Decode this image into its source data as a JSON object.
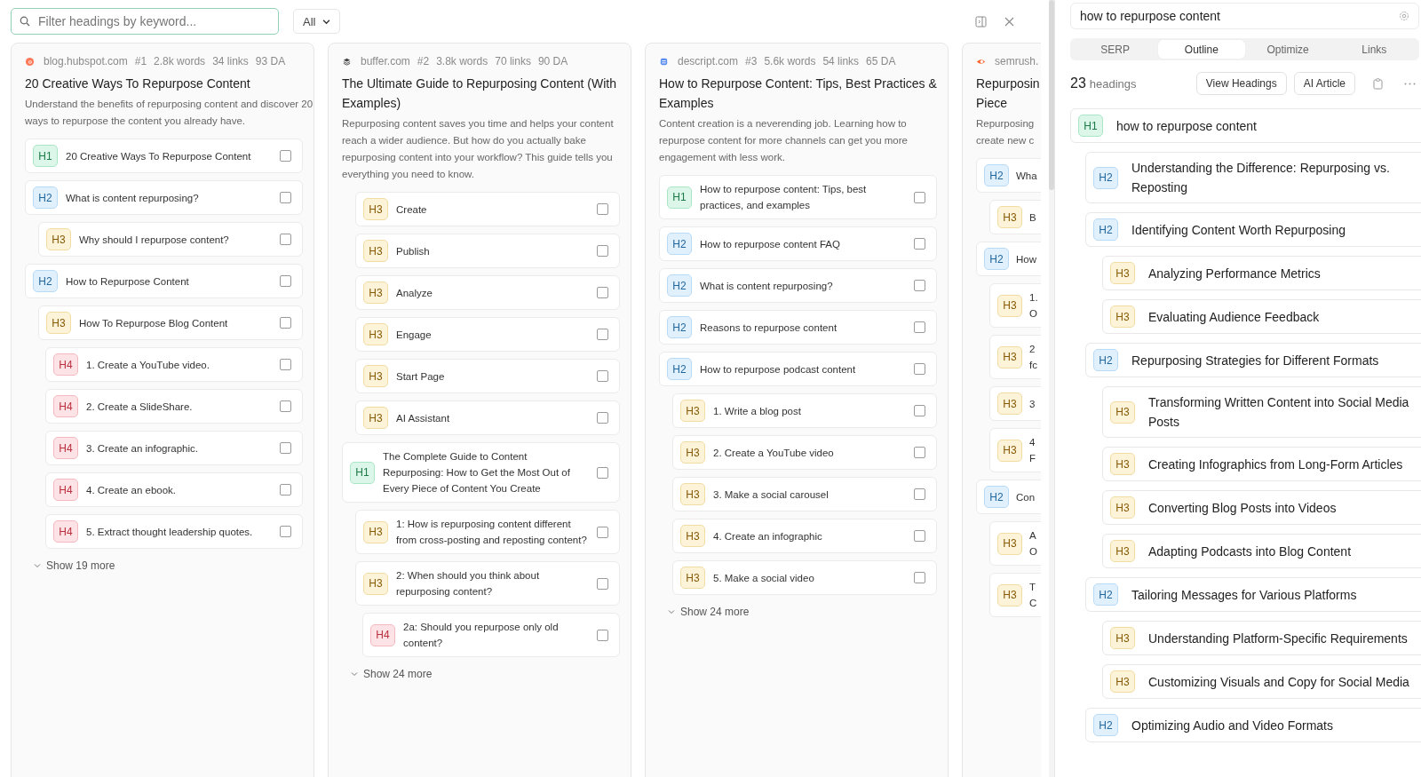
{
  "filter": {
    "placeholder": "Filter headings by keyword..."
  },
  "type_filter": {
    "value": "All"
  },
  "columns": [
    {
      "site": "blog.hubspot.com",
      "rank": "#1",
      "words": "2.8k words",
      "links": "34 links",
      "da": "93 DA",
      "title": "20 Creative Ways To Repurpose Content",
      "description": "Understand the benefits of repurposing content and discover 20 ways to repurpose the content you already have.",
      "headings": [
        {
          "tag": "H1",
          "kind": "h1",
          "text": "20 Creative Ways To Repurpose Content",
          "checked": false
        },
        {
          "tag": "H2",
          "kind": "h2",
          "text": "What is content repurposing?",
          "checked": false
        },
        {
          "tag": "H3",
          "kind": "h3",
          "text": "Why should I repurpose content?",
          "checked": false
        },
        {
          "tag": "H2",
          "kind": "h2",
          "text": "How to Repurpose Content",
          "checked": false
        },
        {
          "tag": "H3",
          "kind": "h3",
          "text": "How To Repurpose Blog Content",
          "checked": false
        },
        {
          "tag": "H4",
          "kind": "h4",
          "text": "1. Create a YouTube video.",
          "checked": false
        },
        {
          "tag": "H4",
          "kind": "h4",
          "text": "2. Create a SlideShare.",
          "checked": false
        },
        {
          "tag": "H4",
          "kind": "h4",
          "text": "3. Create an infographic.",
          "checked": false
        },
        {
          "tag": "H4",
          "kind": "h4",
          "text": "4. Create an ebook.",
          "checked": false
        },
        {
          "tag": "H4",
          "kind": "h4",
          "text": "5. Extract thought leadership quotes.",
          "checked": false
        }
      ],
      "show_more": "Show 19 more"
    },
    {
      "site": "buffer.com",
      "rank": "#2",
      "words": "3.8k words",
      "links": "70 links",
      "da": "90 DA",
      "title": "The Ultimate Guide to Repurposing Content (With Examples)",
      "description": "Repurposing content saves you time and helps your content reach a wider audience. But how do you actually bake repurposing content into your workflow? This guide tells you everything you need to know.",
      "headings": [
        {
          "tag": "H3",
          "kind": "h3",
          "text": "Create",
          "checked": false
        },
        {
          "tag": "H3",
          "kind": "h3",
          "text": "Publish",
          "checked": false
        },
        {
          "tag": "H3",
          "kind": "h3",
          "text": "Analyze",
          "checked": false
        },
        {
          "tag": "H3",
          "kind": "h3",
          "text": "Engage",
          "checked": false
        },
        {
          "tag": "H3",
          "kind": "h3",
          "text": "Start Page",
          "checked": false
        },
        {
          "tag": "H3",
          "kind": "h3",
          "text": "AI Assistant",
          "checked": false
        },
        {
          "tag": "H1",
          "kind": "h1",
          "text": "The Complete Guide to Content Repurposing: How to Get the Most Out of Every Piece of Content You Create",
          "checked": false
        },
        {
          "tag": "H3",
          "kind": "h3",
          "text": "1: How is repurposing content different from cross-posting and reposting content?",
          "checked": false
        },
        {
          "tag": "H3",
          "kind": "h3",
          "text": "2: When should you think about repurposing content?",
          "checked": false
        },
        {
          "tag": "H4",
          "kind": "h4",
          "text": "2a: Should you repurpose only old content?",
          "checked": false
        }
      ],
      "show_more": "Show 24 more"
    },
    {
      "site": "descript.com",
      "rank": "#3",
      "words": "5.6k words",
      "links": "54 links",
      "da": "65 DA",
      "title": "How to Repurpose Content: Tips, Best Practices & Examples",
      "description": "Content creation is a neverending job. Learning how to repurpose content for more channels can get you more engagement with less work.",
      "headings": [
        {
          "tag": "H1",
          "kind": "h1",
          "text": "How to repurpose content: Tips, best practices, and examples",
          "checked": false
        },
        {
          "tag": "H2",
          "kind": "h2",
          "text": "How to repurpose content FAQ",
          "checked": false
        },
        {
          "tag": "H2",
          "kind": "h2",
          "text": "What is content repurposing?",
          "checked": false
        },
        {
          "tag": "H2",
          "kind": "h2",
          "text": "Reasons to repurpose content",
          "checked": false
        },
        {
          "tag": "H2",
          "kind": "h2",
          "text": "How to repurpose podcast content",
          "checked": false
        },
        {
          "tag": "H3",
          "kind": "h3",
          "text": "1. Write a blog post",
          "checked": false
        },
        {
          "tag": "H3",
          "kind": "h3",
          "text": "2. Create a YouTube video",
          "checked": false
        },
        {
          "tag": "H3",
          "kind": "h3",
          "text": "3. Make a social carousel",
          "checked": false
        },
        {
          "tag": "H3",
          "kind": "h3",
          "text": "4. Create an infographic",
          "checked": false
        },
        {
          "tag": "H3",
          "kind": "h3",
          "text": "5. Make a social video",
          "checked": false
        }
      ],
      "show_more": "Show 24 more"
    },
    {
      "site": "semrush.",
      "title": "Repurposin Piece",
      "description": "Repurposing create new c",
      "headings": [
        {
          "tag": "H2",
          "kind": "h2",
          "text": "Wha"
        },
        {
          "tag": "H3",
          "kind": "h3",
          "text": "B"
        },
        {
          "tag": "H2",
          "kind": "h2",
          "text": "How"
        },
        {
          "tag": "H3",
          "kind": "h3",
          "text": "1.\nO"
        },
        {
          "tag": "H3",
          "kind": "h3",
          "text": "2\nfc"
        },
        {
          "tag": "H3",
          "kind": "h3",
          "text": "3"
        },
        {
          "tag": "H3",
          "kind": "h3",
          "text": "4\nF"
        },
        {
          "tag": "H2",
          "kind": "h2",
          "text": "Con"
        },
        {
          "tag": "H3",
          "kind": "h3",
          "text": "A\nO"
        },
        {
          "tag": "H3",
          "kind": "h3",
          "text": "T\nC"
        }
      ]
    }
  ],
  "panel": {
    "keyword": "how to repurpose content",
    "tabs": [
      {
        "label": "SERP",
        "selected": false
      },
      {
        "label": "Outline",
        "selected": true
      },
      {
        "label": "Optimize",
        "selected": false
      },
      {
        "label": "Links",
        "selected": false
      }
    ],
    "count": "23",
    "count_label": "headings",
    "buttons": [
      "View Headings",
      "AI Article"
    ],
    "outline": [
      {
        "tag": "H1",
        "kind": "h1",
        "text": "how to repurpose content"
      },
      {
        "tag": "H2",
        "kind": "h2",
        "text": "Understanding the Difference: Repurposing vs. Reposting"
      },
      {
        "tag": "H2",
        "kind": "h2",
        "text": "Identifying Content Worth Repurposing"
      },
      {
        "tag": "H3",
        "kind": "h3",
        "text": "Analyzing Performance Metrics"
      },
      {
        "tag": "H3",
        "kind": "h3",
        "text": "Evaluating Audience Feedback"
      },
      {
        "tag": "H2",
        "kind": "h2",
        "text": "Repurposing Strategies for Different Formats"
      },
      {
        "tag": "H3",
        "kind": "h3",
        "text": "Transforming Written Content into Social Media Posts"
      },
      {
        "tag": "H3",
        "kind": "h3",
        "text": "Creating Infographics from Long-Form Articles"
      },
      {
        "tag": "H3",
        "kind": "h3",
        "text": "Converting Blog Posts into Videos"
      },
      {
        "tag": "H3",
        "kind": "h3",
        "text": "Adapting Podcasts into Blog Content"
      },
      {
        "tag": "H2",
        "kind": "h2",
        "text": "Tailoring Messages for Various Platforms"
      },
      {
        "tag": "H3",
        "kind": "h3",
        "text": "Understanding Platform-Specific Requirements"
      },
      {
        "tag": "H3",
        "kind": "h3",
        "text": "Customizing Visuals and Copy for Social Media"
      },
      {
        "tag": "H2",
        "kind": "h2",
        "text": "Optimizing Audio and Video Formats"
      }
    ]
  }
}
